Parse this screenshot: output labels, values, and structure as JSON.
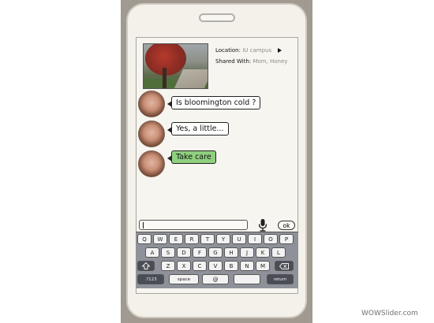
{
  "location": {
    "label": "Location:",
    "value": "IU campus"
  },
  "shared": {
    "label": "Shared With:",
    "value_1": "Mom",
    "separator": ", ",
    "value_2": "Honey"
  },
  "messages": [
    {
      "text": "Is bloomington cold ?",
      "style": "white"
    },
    {
      "text": "Yes, a little...",
      "style": "white"
    },
    {
      "text": "Take care",
      "style": "green"
    }
  ],
  "composer": {
    "ok_label": "ok"
  },
  "keyboard": {
    "row1": [
      "Q",
      "W",
      "E",
      "R",
      "T",
      "Y",
      "U",
      "I",
      "O",
      "P"
    ],
    "row2": [
      "A",
      "S",
      "D",
      "F",
      "G",
      "H",
      "J",
      "K",
      "L"
    ],
    "row3": [
      "Z",
      "X",
      "C",
      "V",
      "B",
      "N",
      "M"
    ],
    "shift_icon": "up-arrow-icon",
    "backspace_icon": "backspace-icon",
    "numbers_label": ".?123",
    "space_label": "space",
    "at_label": "@",
    "return_label": "return"
  },
  "watermark": "WOWSlider.com",
  "colors": {
    "accent_green": "#8ed07e",
    "keyboard_bg": "#8e9199"
  }
}
